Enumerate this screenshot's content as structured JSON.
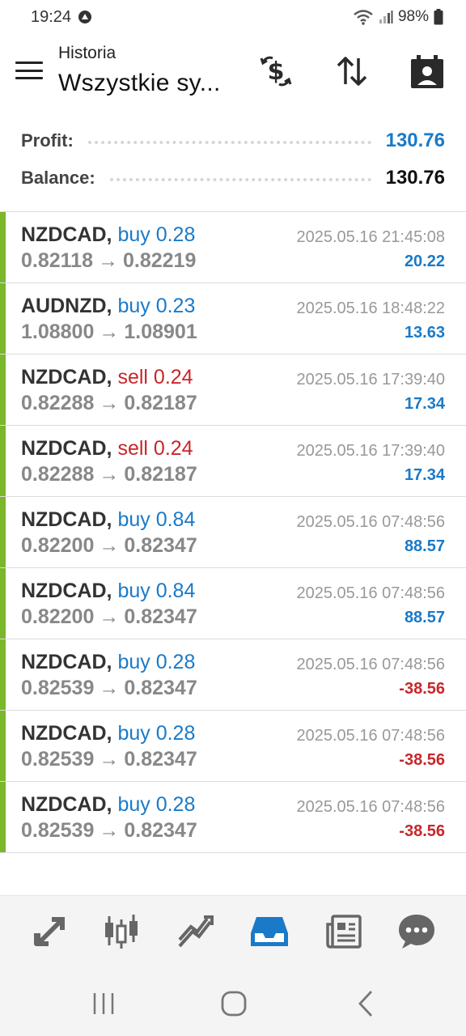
{
  "status_bar": {
    "time": "19:24",
    "battery": "98%"
  },
  "header": {
    "subtitle": "Historia",
    "title": "Wszystkie sy...",
    "icons": [
      "currency-exchange-icon",
      "sort-icon",
      "calendar-icon"
    ]
  },
  "summary": {
    "profit_label": "Profit:",
    "profit_value": "130.76",
    "balance_label": "Balance:",
    "balance_value": "130.76"
  },
  "colors": {
    "buy": "#1a7ac8",
    "sell": "#c8262a",
    "accent_bar": "#7bb72a",
    "active_nav": "#1a7ac8"
  },
  "trades": [
    {
      "symbol": "NZDCAD,",
      "direction": "buy",
      "volume": "buy 0.28",
      "open": "0.82118",
      "close": "0.82219",
      "arrow": "→",
      "date": "2025.05.16 21:45:08",
      "pl": "20.22",
      "pl_sign": "pos"
    },
    {
      "symbol": "AUDNZD,",
      "direction": "buy",
      "volume": "buy 0.23",
      "open": "1.08800",
      "close": "1.08901",
      "arrow": "→",
      "date": "2025.05.16 18:48:22",
      "pl": "13.63",
      "pl_sign": "pos"
    },
    {
      "symbol": "NZDCAD,",
      "direction": "sell",
      "volume": "sell 0.24",
      "open": "0.82288",
      "close": "0.82187",
      "arrow": "→",
      "date": "2025.05.16 17:39:40",
      "pl": "17.34",
      "pl_sign": "pos"
    },
    {
      "symbol": "NZDCAD,",
      "direction": "sell",
      "volume": "sell 0.24",
      "open": "0.82288",
      "close": "0.82187",
      "arrow": "→",
      "date": "2025.05.16 17:39:40",
      "pl": "17.34",
      "pl_sign": "pos"
    },
    {
      "symbol": "NZDCAD,",
      "direction": "buy",
      "volume": "buy 0.84",
      "open": "0.82200",
      "close": "0.82347",
      "arrow": "→",
      "date": "2025.05.16 07:48:56",
      "pl": "88.57",
      "pl_sign": "pos"
    },
    {
      "symbol": "NZDCAD,",
      "direction": "buy",
      "volume": "buy 0.84",
      "open": "0.82200",
      "close": "0.82347",
      "arrow": "→",
      "date": "2025.05.16 07:48:56",
      "pl": "88.57",
      "pl_sign": "pos"
    },
    {
      "symbol": "NZDCAD,",
      "direction": "buy",
      "volume": "buy 0.28",
      "open": "0.82539",
      "close": "0.82347",
      "arrow": "→",
      "date": "2025.05.16 07:48:56",
      "pl": "-38.56",
      "pl_sign": "neg"
    },
    {
      "symbol": "NZDCAD,",
      "direction": "buy",
      "volume": "buy 0.28",
      "open": "0.82539",
      "close": "0.82347",
      "arrow": "→",
      "date": "2025.05.16 07:48:56",
      "pl": "-38.56",
      "pl_sign": "neg"
    },
    {
      "symbol": "NZDCAD,",
      "direction": "buy",
      "volume": "buy 0.28",
      "open": "0.82539",
      "close": "0.82347",
      "arrow": "→",
      "date": "2025.05.16 07:48:56",
      "pl": "-38.56",
      "pl_sign": "neg"
    }
  ],
  "bottom_nav": {
    "items": [
      "quotes-icon",
      "chart-icon",
      "trade-icon",
      "history-icon",
      "news-icon",
      "chat-icon"
    ],
    "active": "history-icon"
  }
}
